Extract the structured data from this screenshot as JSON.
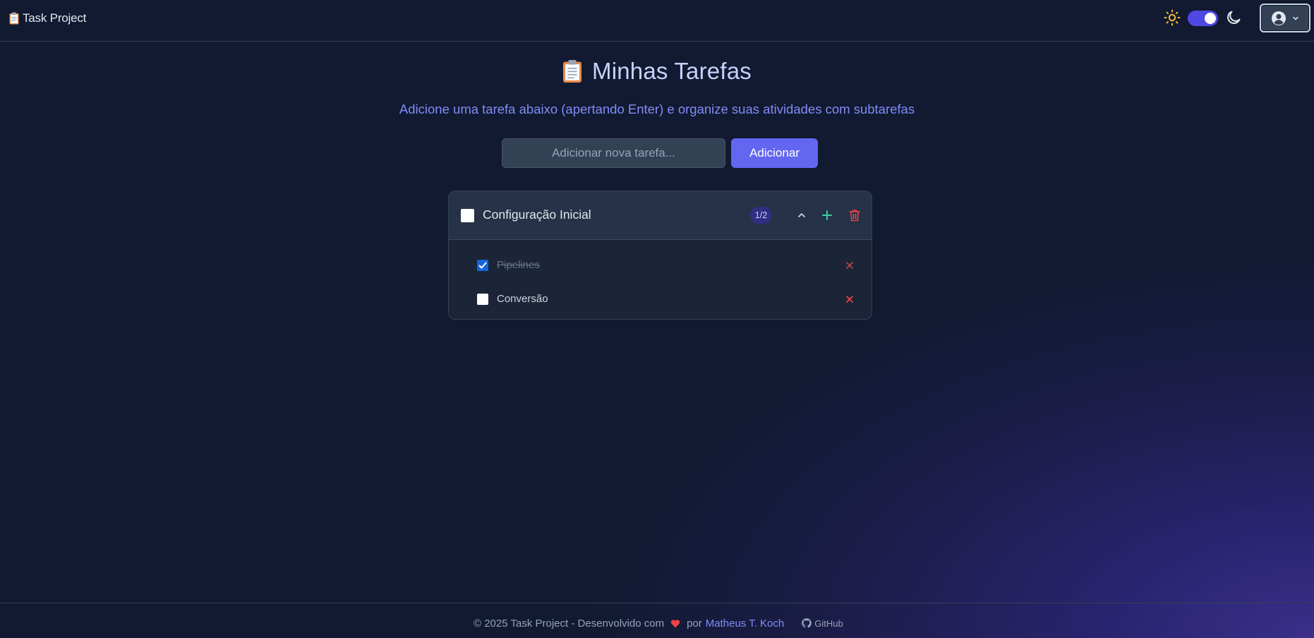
{
  "navbar": {
    "brand": "Task Project",
    "icons": {
      "brand": "clipboard-icon",
      "theme_light": "sun-icon",
      "theme_dark": "moon-icon",
      "user": "user-circle-icon",
      "menu": "chevron-down-icon"
    },
    "dark_mode_enabled": true
  },
  "main": {
    "title": "Minhas Tarefas",
    "subtitle": "Adicione uma tarefa abaixo (apertando Enter) e organize suas atividades com subtarefas",
    "input": {
      "placeholder": "Adicionar nova tarefa...",
      "value": ""
    },
    "add_button": "Adicionar",
    "tasks": [
      {
        "title": "Configuração Inicial",
        "completed": false,
        "progress": "1/2",
        "expanded": true,
        "actions": [
          "chevron-up-icon",
          "plus-icon",
          "trash-icon"
        ],
        "subtasks": [
          {
            "label": "Pipelines",
            "completed": true
          },
          {
            "label": "Conversão",
            "completed": false
          }
        ]
      }
    ]
  },
  "footer": {
    "copyright": "© 2025 Task Project - Desenvolvido com",
    "by": "por",
    "author": "Matheus T. Koch",
    "github": "GitHub"
  },
  "colors": {
    "accent": "#6366f1",
    "title": "#c7d2fe",
    "subtitle": "#818cf8",
    "danger": "#ef4444",
    "success": "#34d399",
    "sun": "#f5b93a"
  }
}
